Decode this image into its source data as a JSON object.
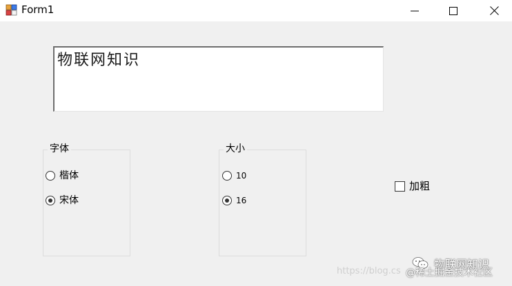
{
  "window": {
    "title": "Form1",
    "icon": "winforms-app-icon",
    "controls": [
      "minimize-icon",
      "maximize-icon",
      "close-icon"
    ]
  },
  "textbox": {
    "value": "物联网知识"
  },
  "font_group": {
    "caption": "字体",
    "options": [
      {
        "label": "楷体",
        "checked": false
      },
      {
        "label": "宋体",
        "checked": true
      }
    ]
  },
  "size_group": {
    "caption": "大小",
    "options": [
      {
        "label": "10",
        "checked": false
      },
      {
        "label": "16",
        "checked": true
      }
    ]
  },
  "bold_checkbox": {
    "label": "加粗",
    "checked": false
  },
  "watermark": {
    "url_text": "https://blog.cs",
    "brand_text": "物联网知识",
    "community_text": "@稀土掘金技术社区",
    "icon": "wechat-icon"
  }
}
